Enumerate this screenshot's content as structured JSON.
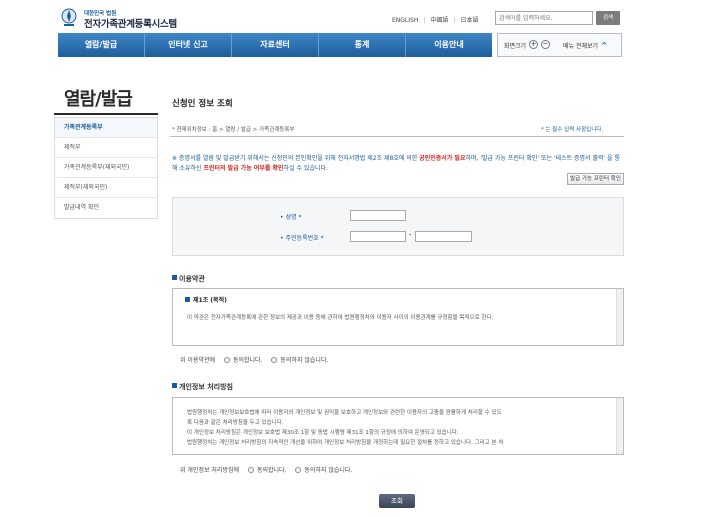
{
  "header": {
    "logo_small": "대한민국 법원",
    "logo_title": "전자가족관계등록시스템",
    "lang_links": [
      "ENGLISH",
      "中國語",
      "日本語"
    ],
    "search_placeholder": "검색어를 입력하세요.",
    "search_button": "검색"
  },
  "gnb": [
    "열람/발급",
    "인터넷 신고",
    "자료센터",
    "통계",
    "이용안내"
  ],
  "util": {
    "zoom_label": "화면크기",
    "zoom_in": "+",
    "zoom_out": "−",
    "menu_all": "메뉴 전체보기"
  },
  "lnb": {
    "title": "열람/발급",
    "items": [
      "가족관계등록부",
      "제적부",
      "가족관계등록부(재외국민)",
      "제적부(재외국민)",
      "발급내역 확인"
    ]
  },
  "content": {
    "title": "신청인 정보 조회",
    "breadcrumb": "* 현재위치정보 : 홈 > 열람 / 발급 > 가족관계등록부",
    "required_note": "* 는 필수 입력 사항입니다.",
    "notice": {
      "p1": "※ 증명서를 열람 및 발급받기 위해서는 신청인의 본인확인을 위해 전자서명법 제2조 제8호에 의한 ",
      "p2": "공인인증서가 필요",
      "p3": "하며, '발급 가능 프린터 확인' 또는 '테스트 증명서 출력' 을 통해 소유하신 ",
      "p4": "프린터의 발급 가능 여부를 확인",
      "p5": "하실 수 있습니다."
    },
    "printer_button": "발급 가능 프린터 확인",
    "form": {
      "name_label": "성명 *",
      "rrn_label": "주민등록번호 *",
      "dash": "-"
    },
    "terms": {
      "section_title": "이용약관",
      "heading": "제1조 (목적)",
      "text": "이 약관은 전자가족관계등록에 관한 정보의 제공과 이용 등에 관하여 법원행정처와 이용자 사이의 이용관계를 규정함을 목적으로 한다.",
      "agree_label": "위 이용약관에",
      "agree": "동의합니다.",
      "disagree": "동의하지 않습니다."
    },
    "privacy": {
      "section_title": "개인정보 처리방침",
      "lines": [
        "법원행정처는 개인정보보호법에 따라 이용자의 개인정보 및 권익을 보호하고 개인정보와 관련한 이용자의 고충을 원활하게 처리할 수 있도",
        "록 다음과 같은 처리방침을 두고 있습니다.",
        "이 개인정보 처리방침은 개인정보 보호법 제30조 1항 및 동법 시행령 제31조 1항의 규정에 의하여 운영되고 있습니다.",
        "법원행정처는 개인정보 처리방침의 지속적인 개선을 위하여 개인정보 처리방침을 개정하는데 필요한 절차를 정하고 있습니다. 그리고 본 처"
      ],
      "agree_label": "위 개인정보 처리방침에",
      "agree": "동의합니다.",
      "disagree": "동의하지 않습니다."
    },
    "submit": "조회"
  }
}
